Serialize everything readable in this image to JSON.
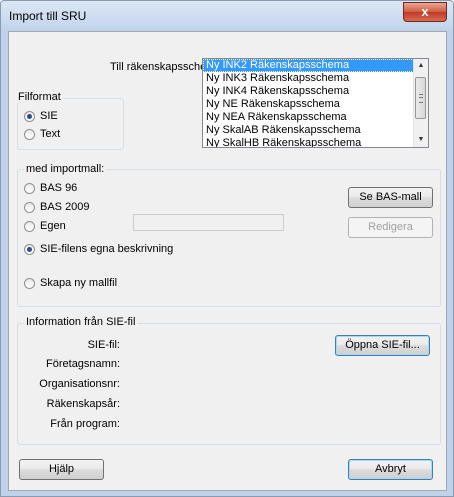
{
  "window": {
    "title": "Import till SRU",
    "close_glyph": "x"
  },
  "schema": {
    "label": "Till räkenskapsschema:",
    "items": [
      "Ny INK2 Räkenskapsschema",
      "Ny INK3 Räkenskapsschema",
      "Ny INK4 Räkenskapsschema",
      "Ny NE Räkenskapsschema",
      "Ny NEA Räkenskapsschema",
      "Ny SkalAB Räkenskapsschema",
      "Ny SkalHB Räkenskapsschema"
    ],
    "selected_index": 0
  },
  "fileformat": {
    "title": "Filformat",
    "options": [
      "SIE",
      "Text"
    ],
    "selected": "SIE"
  },
  "template": {
    "title": "med importmall:",
    "options": {
      "bas96": "BAS 96",
      "bas2009": "BAS 2009",
      "egen": "Egen",
      "sie_desc": "SIE-filens egna beskrivning",
      "new_template": "Skapa ny mallfil"
    },
    "selected": "sie_desc",
    "egen_value": "",
    "see_bas_button": "Se BAS-mall",
    "edit_button": "Redigera"
  },
  "info": {
    "title": "Information från SIE-fil",
    "fields": {
      "sie_file": "SIE-fil:",
      "company": "Företagsnamn:",
      "org_nr": "Organisationsnr:",
      "fiscal_year": "Räkenskapsår:",
      "from_program": "Från program:"
    },
    "open_button": "Öppna SIE-fil..."
  },
  "footer": {
    "help_button": "Hjälp",
    "cancel_button": "Avbryt"
  }
}
